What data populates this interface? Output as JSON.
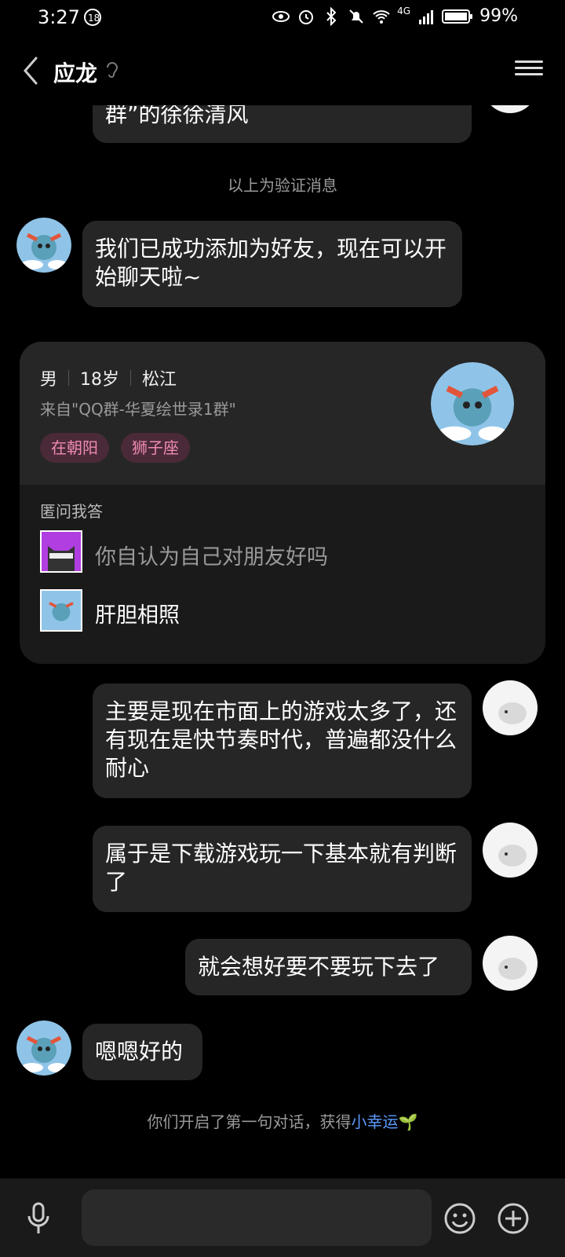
{
  "status_bar": {
    "time": "3:27",
    "battery": "99%",
    "network": "4G"
  },
  "header": {
    "title": "应龙"
  },
  "messages": {
    "partial_top": "群”的徐徐清风",
    "verify_note": "以上为验证消息",
    "friend_added": "我们已成功添加为好友，现在可以开始聊天啦~",
    "sent1": "主要是现在市面上的游戏太多了，还有现在是快节奏时代，普遍都没什么耐心",
    "sent2": "属于是下载游戏玩一下基本就有判断了",
    "sent3": "就会想好要不要玩下去了",
    "received_last": "嗯嗯好的",
    "bottom_note_prefix": "你们开启了第一句对话，获得",
    "bottom_note_link": "小幸运",
    "bottom_note_emoji": "🌱"
  },
  "profile_card": {
    "gender": "男",
    "age": "18岁",
    "location": "松江",
    "source": "来自\"QQ群-华夏绘世录1群\"",
    "tags": [
      "在朝阳",
      "狮子座"
    ],
    "qa_title": "匿问我答",
    "qa_items": [
      {
        "text": "你自认为自己对朋友好吗",
        "icon": "cat-sunglasses-icon"
      },
      {
        "text": "肝胆相照",
        "icon": "dragon-avatar-icon"
      }
    ]
  },
  "input": {
    "placeholder": ""
  },
  "colors": {
    "bg": "#000000",
    "bubble": "#262626",
    "link": "#5b9bff",
    "tag_text": "#f08ab5",
    "tag_bg": "#4a2a38"
  }
}
